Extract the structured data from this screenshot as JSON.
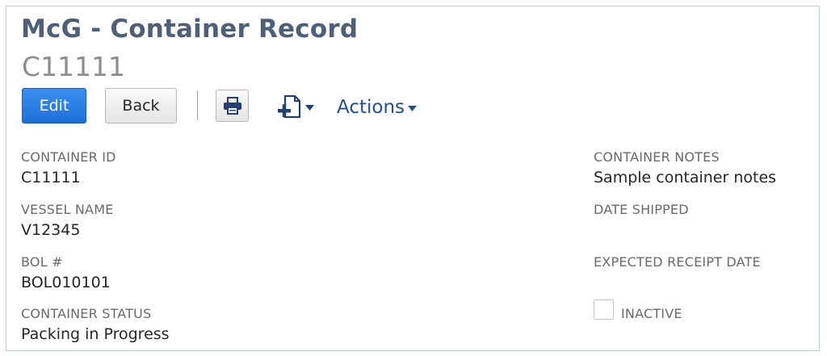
{
  "header": {
    "title": "McG - Container Record",
    "record_id": "C11111"
  },
  "toolbar": {
    "edit_label": "Edit",
    "back_label": "Back",
    "print_icon": "print-icon",
    "new_icon": "new-document-plus-icon",
    "actions_label": "Actions"
  },
  "fields": {
    "container_id": {
      "label": "CONTAINER ID",
      "value": "C11111"
    },
    "vessel_name": {
      "label": "VESSEL NAME",
      "value": "V12345"
    },
    "bol": {
      "label": "BOL #",
      "value": "BOL010101"
    },
    "container_status": {
      "label": "CONTAINER STATUS",
      "value": "Packing in Progress"
    },
    "container_notes": {
      "label": "CONTAINER NOTES",
      "value": "Sample container notes"
    },
    "date_shipped": {
      "label": "DATE SHIPPED",
      "value": ""
    },
    "expected_receipt_date": {
      "label": "EXPECTED RECEIPT DATE",
      "value": ""
    },
    "inactive": {
      "label": "INACTIVE",
      "checked": false
    }
  },
  "colors": {
    "title": "#4d5f79",
    "edit_button": "#2a80e8",
    "actions_link": "#22508f",
    "frame_border": "#b9cde6"
  }
}
